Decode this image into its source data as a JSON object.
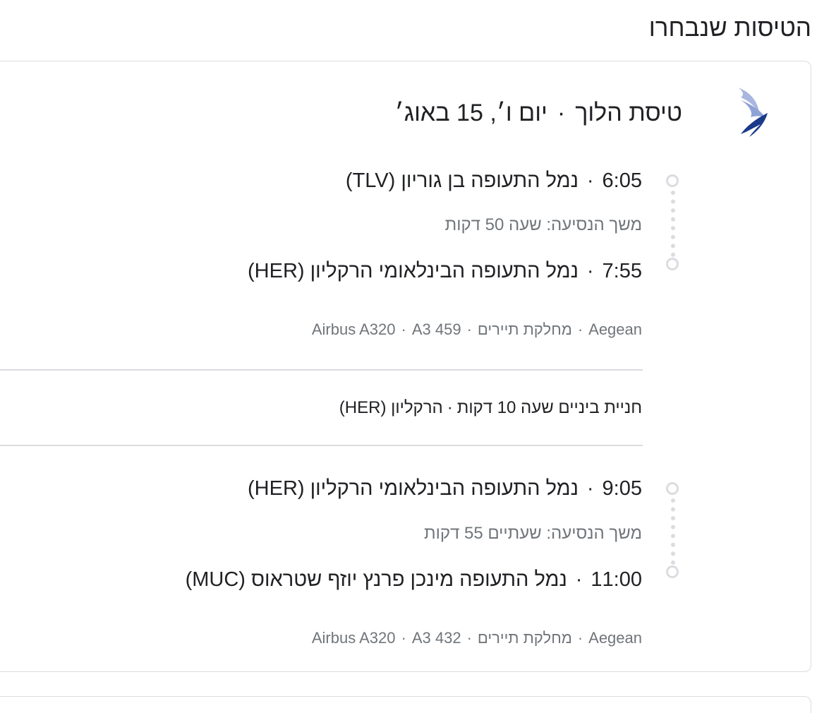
{
  "section": {
    "title": "הטיסות שנבחרו"
  },
  "airline": {
    "logo_icon": "aegean-logo-icon",
    "brand_color": "#1a3a8a",
    "accent_color": "#8fa3d6"
  },
  "trip": {
    "label": "טיסת הלוך",
    "date": "יום ו׳, 15 באוג׳"
  },
  "segments": [
    {
      "departure": {
        "time": "6:05",
        "airport": "נמל התעופה בן גוריון (TLV)"
      },
      "duration": "משך הנסיעה: שעה 50 דקות",
      "arrival": {
        "time": "7:55",
        "airport": "נמל התעופה הבינלאומי הרקליון (HER)"
      },
      "meta": {
        "airline": "Aegean",
        "cabin": "מחלקת תיירים",
        "aircraft": "Airbus A320",
        "flight_number": "A3 459"
      }
    },
    {
      "departure": {
        "time": "9:05",
        "airport": "נמל התעופה הבינלאומי הרקליון (HER)"
      },
      "duration": "משך הנסיעה: שעתיים 55 דקות",
      "arrival": {
        "time": "11:00",
        "airport": "נמל התעופה מינכן פרנץ יוזף שטראוס (MUC)"
      },
      "meta": {
        "airline": "Aegean",
        "cabin": "מחלקת תיירים",
        "aircraft": "Airbus A320",
        "flight_number": "A3 432"
      }
    }
  ],
  "layover": {
    "duration": "חניית ביניים שעה 10 דקות",
    "location": "הרקליון (HER)"
  },
  "separator": "·",
  "colors": {
    "text": "#202124",
    "secondary_text": "#70757a",
    "border": "#dadce0"
  }
}
